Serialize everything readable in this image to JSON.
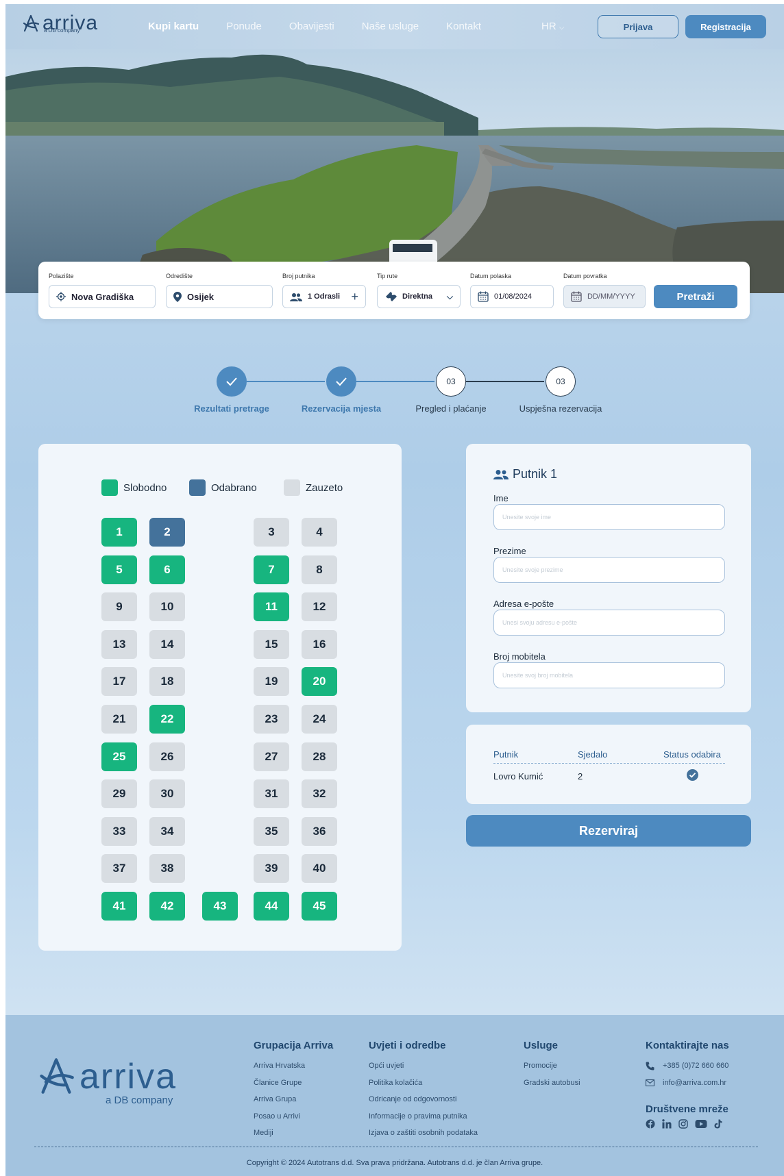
{
  "header": {
    "logo_text": "arriva",
    "logo_sub": "a DB company",
    "nav": [
      "Kupi kartu",
      "Ponude",
      "Obavijesti",
      "Naše usluge",
      "Kontakt"
    ],
    "language": "HR",
    "login_label": "Prijava",
    "register_label": "Registracija"
  },
  "search": {
    "departure_label": "Polazište",
    "departure_value": "Nova Gradiška",
    "destination_label": "Odredište",
    "destination_value": "Osijek",
    "passengers_label": "Broj putnika",
    "passengers_value": "1 Odrasli",
    "route_label": "Tip rute",
    "route_value": "Direktna",
    "departure_date_label": "Datum polaska",
    "departure_date_value": "01/08/2024",
    "return_date_label": "Datum povratka",
    "return_date_placeholder": "DD/MM/YYYY",
    "search_button": "Pretraži"
  },
  "steps": [
    {
      "label": "Rezultati pretrage",
      "status": "done"
    },
    {
      "label": "Rezervacija mjesta",
      "status": "done"
    },
    {
      "label": "Pregled i plaćanje",
      "status": "todo",
      "number": "03"
    },
    {
      "label": "Uspješna rezervacija",
      "status": "todo",
      "number": "03"
    }
  ],
  "legend": {
    "free": "Slobodno",
    "selected": "Odabrano",
    "taken": "Zauzeto"
  },
  "seats": {
    "free": [
      1,
      5,
      6,
      7,
      11,
      20,
      22,
      25,
      41,
      42,
      43,
      44,
      45
    ],
    "selected": [
      2
    ],
    "taken": [
      3,
      4,
      8,
      9,
      10,
      12,
      13,
      14,
      15,
      16,
      17,
      18,
      19,
      21,
      23,
      24,
      26,
      27,
      28,
      29,
      30,
      31,
      32,
      33,
      34,
      35,
      36,
      37,
      38,
      39,
      40
    ]
  },
  "passenger_form": {
    "title": "Putnik 1",
    "first_name_label": "Ime",
    "first_name_placeholder": "Unesite svoje ime",
    "last_name_label": "Prezime",
    "last_name_placeholder": "Unesite svoje prezime",
    "email_label": "Adresa e-pošte",
    "email_placeholder": "Unesi svoju adresu e-pošte",
    "phone_label": "Broj mobitela",
    "phone_placeholder": "Unesite svoj broj mobitela"
  },
  "summary": {
    "col_passenger": "Putnik",
    "col_seat": "Sjedalo",
    "col_status": "Status odabira",
    "passenger_name": "Lovro Kumić",
    "seat": "2"
  },
  "reserve_button": "Rezerviraj",
  "footer": {
    "logo_text": "arriva",
    "logo_sub": "a DB company",
    "col1_title": "Grupacija Arriva",
    "col1_items": [
      "Arriva Hrvatska",
      "Članice Grupe",
      "Arriva Grupa",
      "Posao u Arrivi",
      "Mediji"
    ],
    "col2_title": "Uvjeti i odredbe",
    "col2_items": [
      "Opći uvjeti",
      "Politika kolačića",
      "Odricanje od odgovornosti",
      "Informacije o pravima putnika",
      "Izjava o zaštiti osobnih podataka"
    ],
    "col3_title": "Usluge",
    "col3_items": [
      "Promocije",
      "Gradski autobusi"
    ],
    "col4_title": "Kontaktirajte nas",
    "phone": "+385 (0)72 660 660",
    "email": "info@arriva.com.hr",
    "social_title": "Društvene mreže",
    "copyright": "Copyright © 2024 Autotrans d.d. Sva prava pridržana. Autotrans d.d. je član Arriva grupe."
  },
  "colors": {
    "primary": "#4d8ac0",
    "free_seat": "#17b57f",
    "selected_seat": "#44729b",
    "taken_seat": "#d8dde2"
  }
}
